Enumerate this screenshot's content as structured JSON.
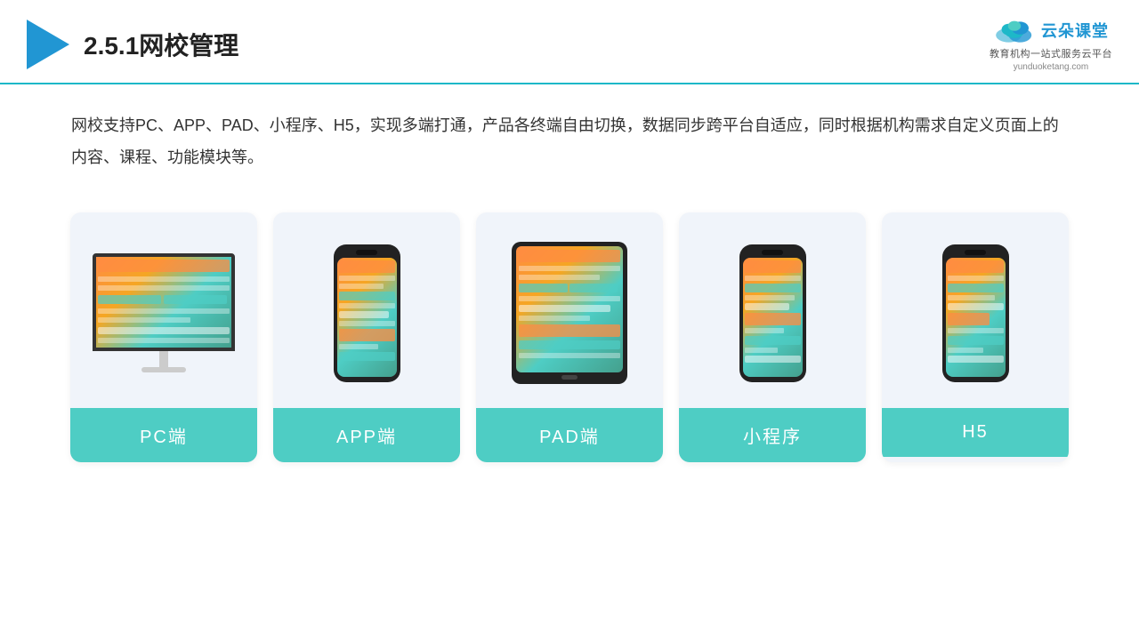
{
  "header": {
    "title": "2.5.1网校管理",
    "brand": {
      "name": "云朵课堂",
      "url": "yunduoketang.com",
      "tagline": "教育机构一站\n式服务云平台"
    }
  },
  "description": "网校支持PC、APP、PAD、小程序、H5，实现多端打通，产品各终端自由切换，数据同步跨平台自适应，同时根据机构需求自定义页面上的内容、课程、功能模块等。",
  "cards": [
    {
      "id": "pc",
      "label": "PC端",
      "type": "monitor"
    },
    {
      "id": "app",
      "label": "APP端",
      "type": "phone"
    },
    {
      "id": "pad",
      "label": "PAD端",
      "type": "tablet"
    },
    {
      "id": "miniapp",
      "label": "小程序",
      "type": "phone"
    },
    {
      "id": "h5",
      "label": "H5",
      "type": "phone"
    }
  ],
  "accent_color": "#4ecdc4"
}
